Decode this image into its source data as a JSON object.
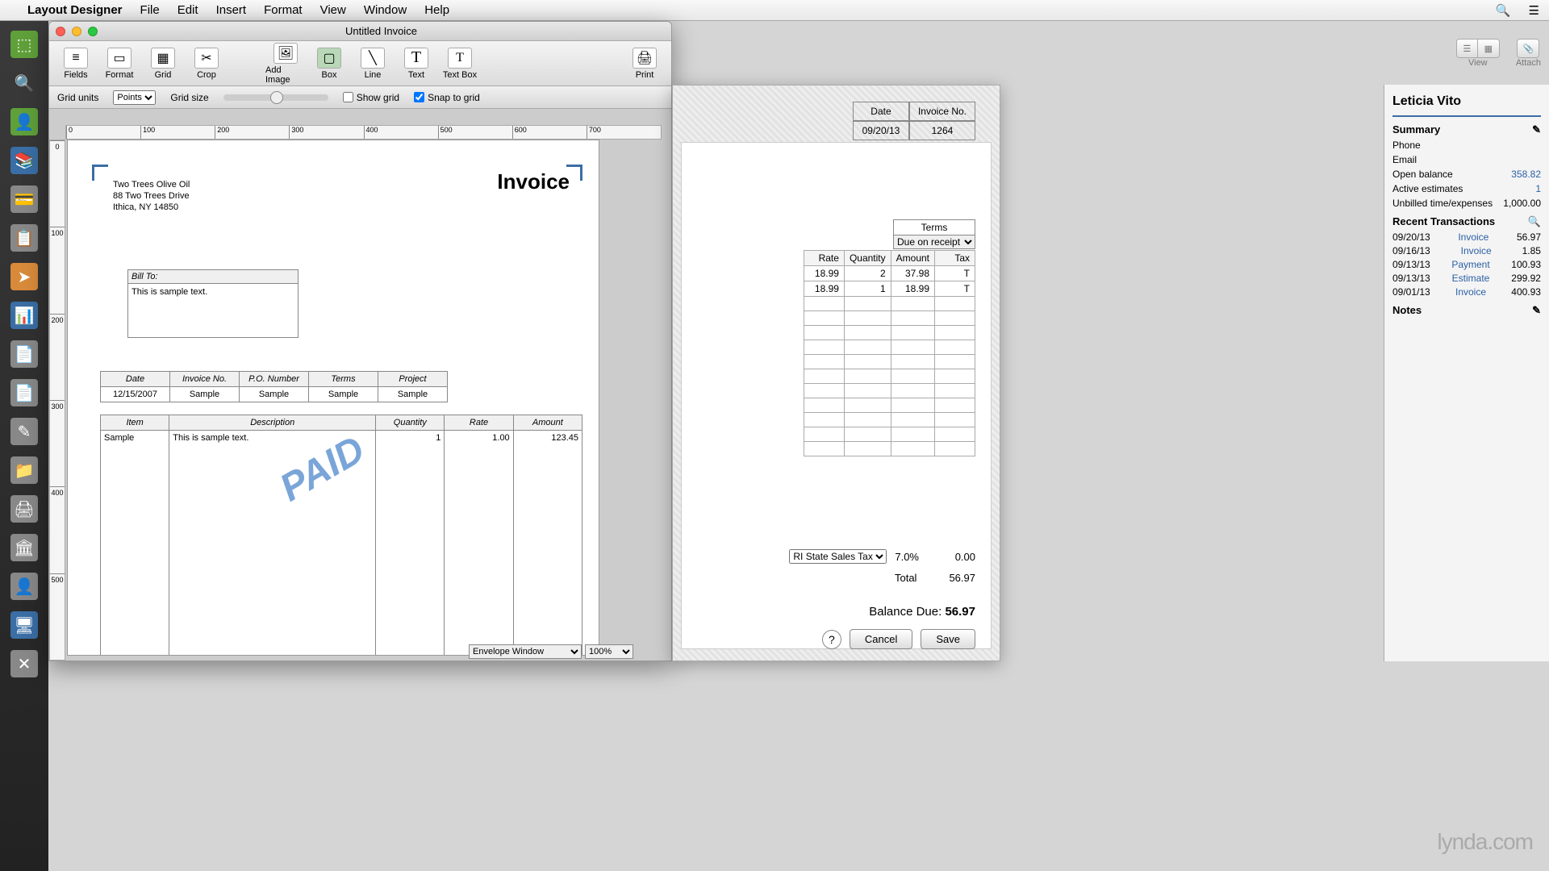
{
  "menubar": {
    "app": "Layout Designer",
    "items": [
      "File",
      "Edit",
      "Insert",
      "Format",
      "View",
      "Window",
      "Help"
    ]
  },
  "dock_icons": [
    "green",
    "gray",
    "green",
    "blue",
    "gray",
    "gray",
    "orange",
    "blue",
    "gray",
    "gray",
    "gray",
    "gray",
    "gray",
    "blue",
    "gray",
    "blue",
    "gray"
  ],
  "window": {
    "title": "Untitled Invoice",
    "tools": {
      "fields": "Fields",
      "format": "Format",
      "grid": "Grid",
      "crop": "Crop",
      "add_image": "Add Image",
      "box": "Box",
      "line": "Line",
      "text": "Text",
      "text_box": "Text Box",
      "print": "Print"
    },
    "optbar": {
      "grid_units_label": "Grid units",
      "grid_units_value": "Points",
      "grid_size_label": "Grid size",
      "show_grid": "Show grid",
      "snap_grid": "Snap to grid"
    },
    "ruler_h": [
      "0",
      "100",
      "200",
      "300",
      "400",
      "500",
      "600",
      "700"
    ],
    "ruler_v": [
      "0",
      "100",
      "200",
      "300",
      "400",
      "500"
    ],
    "page": {
      "company": "Two Trees Olive Oil",
      "addr1": "88 Two Trees Drive",
      "addr2": "Ithica, NY 14850",
      "title": "Invoice",
      "billto_label": "Bill To:",
      "billto_text": "This is sample text.",
      "info_headers": [
        "Date",
        "Invoice No.",
        "P.O. Number",
        "Terms",
        "Project"
      ],
      "info_row": [
        "12/15/2007",
        "Sample",
        "Sample",
        "Sample",
        "Sample"
      ],
      "item_headers": [
        "Item",
        "Description",
        "Quantity",
        "Rate",
        "Amount"
      ],
      "item_row": [
        "Sample",
        "This is sample text.",
        "1",
        "1.00",
        "123.45"
      ],
      "paid": "PAID"
    },
    "bottombar": {
      "envelope": "Envelope Window",
      "zoom": "100%"
    }
  },
  "top_right": {
    "view": "View",
    "attach": "Attach"
  },
  "behind": {
    "date_h": "Date",
    "date_v": "09/20/13",
    "invno_h": "Invoice No.",
    "invno_v": "1264",
    "terms_h": "Terms",
    "terms_v": "Due on receipt",
    "cols": [
      "Rate",
      "Quantity",
      "Amount",
      "Tax"
    ],
    "rows": [
      [
        "18.99",
        "2",
        "37.98",
        "T"
      ],
      [
        "18.99",
        "1",
        "18.99",
        "T"
      ]
    ],
    "tax_item": "RI State Sales Tax",
    "tax_pct": "7.0%",
    "tax_amt": "0.00",
    "total_label": "Total",
    "total_val": "56.97",
    "balance_label": "Balance Due:",
    "balance_val": "56.97",
    "cancel": "Cancel",
    "save": "Save"
  },
  "sidebar": {
    "customer": "Leticia Vito",
    "summary": "Summary",
    "phone": "Phone",
    "email": "Email",
    "open_balance_l": "Open balance",
    "open_balance_v": "358.82",
    "active_est_l": "Active estimates",
    "active_est_v": "1",
    "unbilled_l": "Unbilled time/expenses",
    "unbilled_v": "1,000.00",
    "recent": "Recent Transactions",
    "transactions": [
      {
        "d": "09/20/13",
        "t": "Invoice",
        "a": "56.97"
      },
      {
        "d": "09/16/13",
        "t": "Invoice",
        "a": "1.85"
      },
      {
        "d": "09/13/13",
        "t": "Payment",
        "a": "100.93"
      },
      {
        "d": "09/13/13",
        "t": "Estimate",
        "a": "299.92"
      },
      {
        "d": "09/01/13",
        "t": "Invoice",
        "a": "400.93"
      }
    ],
    "notes": "Notes"
  },
  "watermark": "lynda.com"
}
